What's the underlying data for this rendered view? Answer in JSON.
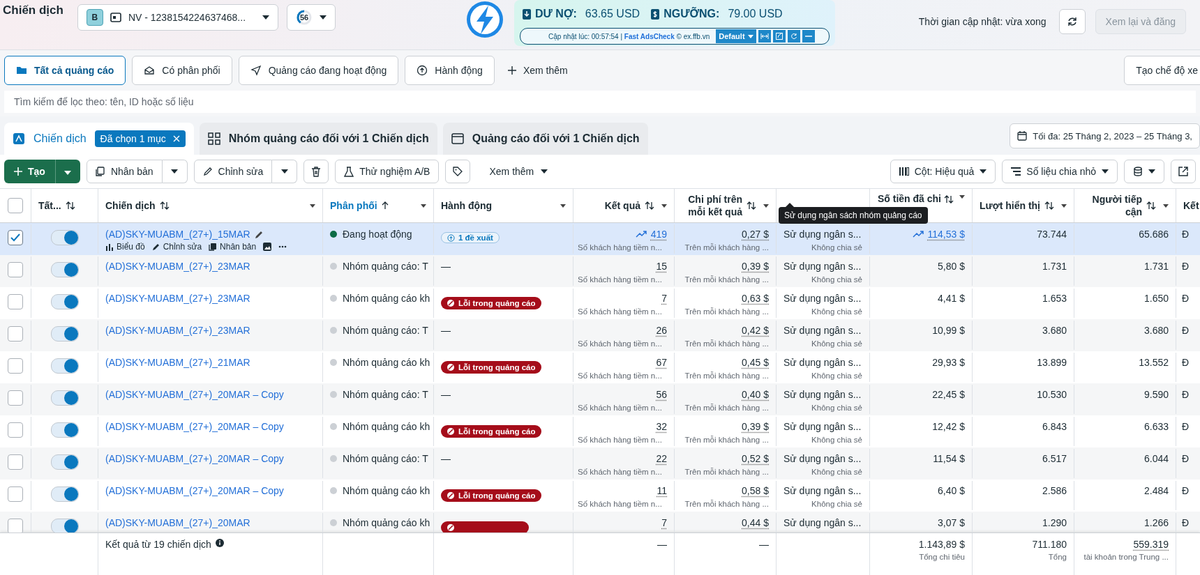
{
  "top_bar": {
    "title": "Chiến dịch",
    "account": {
      "badge": "B",
      "name": "NV - 1238154224637468..."
    },
    "counter": {
      "value": "56",
      "level": 0.4
    },
    "extension": {
      "debt_label": "DƯ NỢ:",
      "debt": "63.65 USD",
      "limit_label": "NGƯỠNG:",
      "limit": "79.00 USD",
      "updated": "Cập nhật lúc: 00:57:54 |",
      "brand": "Fast AdsCheck",
      "site": "© ex.ffb.vn",
      "preset": "Default"
    },
    "update_time": "Thời gian cập nhật: vừa xong",
    "publish_button": {
      "label": "Xem lại và đăng",
      "disabled": true
    }
  },
  "filters": [
    {
      "label": "Tất cả quảng cáo",
      "selected": true
    },
    {
      "label": "Có phân phối",
      "selected": false
    },
    {
      "label": "Quảng cáo đang hoạt động",
      "selected": false
    },
    {
      "label": "Hành động",
      "selected": false
    }
  ],
  "more_filters": "Xem thêm",
  "create_view": "Tạo chế độ xe",
  "search": {
    "placeholder": "Tìm kiếm để lọc theo: tên, ID hoặc số liệu"
  },
  "level_tabs": [
    {
      "label": "Chiến dịch",
      "selected": true,
      "chip": "Đã chọn 1 mục"
    },
    {
      "label": "Nhóm quảng cáo đối với 1 Chiến dịch",
      "selected": false
    },
    {
      "label": "Quảng cáo đối với 1 Chiến dịch",
      "selected": false
    }
  ],
  "date_range": "Tối đa: 25 Tháng 2, 2023 – 25 Tháng 3,",
  "toolbar": {
    "create": "Tạo",
    "duplicate": "Nhân bản",
    "edit": "Chỉnh sửa",
    "ab_test": "Thử nghiệm A/B",
    "more": "Xem thêm",
    "columns": "Cột: Hiệu quả",
    "breakdown": "Số liệu chia nhỏ"
  },
  "table": {
    "select_all": {
      "checked": false
    },
    "columns": [
      {
        "label": "Tất...",
        "sortable": true,
        "sorted": false,
        "menu": false
      },
      {
        "label": "Chiến dịch",
        "sortable": true,
        "sorted": false,
        "menu": true
      },
      {
        "label": "Phân phối",
        "sortable": true,
        "sorted": true,
        "menu": true
      },
      {
        "label": "Hành động",
        "sortable": false,
        "sorted": false,
        "menu": true
      },
      {
        "label": "Kết quả",
        "sortable": true,
        "sorted": false,
        "menu": true
      },
      {
        "label": "Chi phí trên mỗi kết quả",
        "sortable": true,
        "sorted": false,
        "menu": true
      },
      {
        "sortable": false,
        "menu": false
      },
      {
        "label": "Số tiền đã chi",
        "sortable": true,
        "sorted": false,
        "menu": true
      },
      {
        "label": "Lượt hiển thị",
        "sortable": true,
        "sorted": false,
        "menu": true
      },
      {
        "label": "Người tiếp cận",
        "sortable": true,
        "sorted": false,
        "menu": true
      },
      {
        "label": "Kết",
        "sortable": false,
        "sorted": false,
        "menu": false
      }
    ],
    "tooltip": "Sử dụng ngân sách nhóm quảng cáo",
    "rows": [
      {
        "selected": true,
        "on": true,
        "name": "(AD)SKY-MUABM_(27+)_15MAR",
        "links": [
          "Biểu đồ",
          "Chỉnh sửa",
          "Nhân bản"
        ],
        "status": {
          "text": "Đang hoạt động",
          "active": true
        },
        "action": {
          "kind": "suggestion",
          "label": "1 đề xuất"
        },
        "trend": true,
        "result": "419",
        "result_note": "Số khách hàng tiềm n...",
        "cost": "0,27 $",
        "cost_note": "Trên mỗi khách hàng ...",
        "budget": "Sử dụng ngân s...",
        "budget_note": "Không chia sẻ",
        "spent": "114,53 $",
        "impressions": "73.744",
        "reach": "65.686",
        "column_12": "Đ"
      },
      {
        "selected": false,
        "on": true,
        "name": "(AD)SKY-MUABM_(27+)_23MAR",
        "status": {
          "text": "Nhóm quảng cáo: T",
          "active": false
        },
        "action": {
          "kind": "none",
          "label": "—"
        },
        "trend": false,
        "result": "15",
        "result_note": "Số khách hàng tiềm n...",
        "cost": "0,39 $",
        "cost_note": "Trên mỗi khách hàng ...",
        "budget": "Sử dụng ngân s...",
        "budget_note": "Không chia sẻ",
        "spent": "5,80 $",
        "impressions": "1.731",
        "reach": "1.731",
        "column_12": "Đ"
      },
      {
        "selected": false,
        "on": true,
        "name": "(AD)SKY-MUABM_(27+)_23MAR",
        "status": {
          "text": "Nhóm quảng cáo kh",
          "active": false
        },
        "action": {
          "kind": "error",
          "label": "Lỗi trong quảng cáo"
        },
        "trend": false,
        "result": "7",
        "result_note": "Số khách hàng tiềm n...",
        "cost": "0,63 $",
        "cost_note": "Trên mỗi khách hàng ...",
        "budget": "Sử dụng ngân s...",
        "budget_note": "Không chia sẻ",
        "spent": "4,41 $",
        "impressions": "1.653",
        "reach": "1.650",
        "column_12": "Đ"
      },
      {
        "selected": false,
        "on": true,
        "name": "(AD)SKY-MUABM_(27+)_23MAR",
        "status": {
          "text": "Nhóm quảng cáo: T",
          "active": false
        },
        "action": {
          "kind": "none",
          "label": "—"
        },
        "trend": false,
        "result": "26",
        "result_note": "Số khách hàng tiềm n...",
        "cost": "0,42 $",
        "cost_note": "Trên mỗi khách hàng ...",
        "budget": "Sử dụng ngân s...",
        "budget_note": "Không chia sẻ",
        "spent": "10,99 $",
        "impressions": "3.680",
        "reach": "3.680",
        "column_12": "Đ"
      },
      {
        "selected": false,
        "on": true,
        "name": "(AD)SKY-MUABM_(27+)_21MAR",
        "status": {
          "text": "Nhóm quảng cáo kh",
          "active": false
        },
        "action": {
          "kind": "error",
          "label": "Lỗi trong quảng cáo"
        },
        "trend": false,
        "result": "67",
        "result_note": "Số khách hàng tiềm n...",
        "cost": "0,45 $",
        "cost_note": "Trên mỗi khách hàng ...",
        "budget": "Sử dụng ngân s...",
        "budget_note": "Không chia sẻ",
        "spent": "29,93 $",
        "impressions": "13.899",
        "reach": "13.552",
        "column_12": "Đ"
      },
      {
        "selected": false,
        "on": true,
        "name": "(AD)SKY-MUABM_(27+)_20MAR – Copy",
        "status": {
          "text": "Nhóm quảng cáo: T",
          "active": false
        },
        "action": {
          "kind": "none",
          "label": "—"
        },
        "trend": false,
        "result": "56",
        "result_note": "Số khách hàng tiềm n...",
        "cost": "0,40 $",
        "cost_note": "Trên mỗi khách hàng ...",
        "budget": "Sử dụng ngân s...",
        "budget_note": "Không chia sẻ",
        "spent": "22,45 $",
        "impressions": "10.530",
        "reach": "9.590",
        "column_12": "Đ"
      },
      {
        "selected": false,
        "on": true,
        "name": "(AD)SKY-MUABM_(27+)_20MAR – Copy",
        "status": {
          "text": "Nhóm quảng cáo kh",
          "active": false
        },
        "action": {
          "kind": "error",
          "label": "Lỗi trong quảng cáo"
        },
        "trend": false,
        "result": "32",
        "result_note": "Số khách hàng tiềm n...",
        "cost": "0,39 $",
        "cost_note": "Trên mỗi khách hàng ...",
        "budget": "Sử dụng ngân s...",
        "budget_note": "Không chia sẻ",
        "spent": "12,42 $",
        "impressions": "6.843",
        "reach": "6.633",
        "column_12": "Đ"
      },
      {
        "selected": false,
        "on": true,
        "name": "(AD)SKY-MUABM_(27+)_20MAR – Copy",
        "status": {
          "text": "Nhóm quảng cáo: T",
          "active": false
        },
        "action": {
          "kind": "none",
          "label": "—"
        },
        "trend": false,
        "result": "22",
        "result_note": "Số khách hàng tiềm n...",
        "cost": "0,52 $",
        "cost_note": "Trên mỗi khách hàng ...",
        "budget": "Sử dụng ngân s...",
        "budget_note": "Không chia sẻ",
        "spent": "11,54 $",
        "impressions": "6.517",
        "reach": "6.044",
        "column_12": "Đ"
      },
      {
        "selected": false,
        "on": true,
        "name": "(AD)SKY-MUABM_(27+)_20MAR – Copy",
        "status": {
          "text": "Nhóm quảng cáo kh",
          "active": false
        },
        "action": {
          "kind": "error",
          "label": "Lỗi trong quảng cáo"
        },
        "trend": false,
        "result": "11",
        "result_note": "Số khách hàng tiềm n...",
        "cost": "0,58 $",
        "cost_note": "Trên mỗi khách hàng ...",
        "budget": "Sử dụng ngân s...",
        "budget_note": "Không chia sẻ",
        "spent": "6,40 $",
        "impressions": "2.586",
        "reach": "2.484",
        "column_12": "Đ"
      },
      {
        "selected": false,
        "on": true,
        "name": "(AD)SKY-MUABM_(27+)_20MAR",
        "status": {
          "text": "Nhóm quảng cáo kh",
          "active": false
        },
        "action": {
          "kind": "error"
        },
        "trend": false,
        "result": "7",
        "cost": "0,44 $",
        "budget": "Sử dụng ngân s...",
        "spent": "3,07 $",
        "impressions": "1.290",
        "reach": "1.266",
        "column_12": "Đ"
      }
    ],
    "footer": {
      "summary": "Kết quả từ 19 chiến dịch",
      "result": "—",
      "cost": "—",
      "spent": "1.143,89 $",
      "spent_note": "Tổng chi tiêu",
      "impressions": "711.180",
      "impressions_note": "Tổng",
      "reach": "559.319",
      "reach_note": "tài khoản trong Trung ..."
    }
  }
}
